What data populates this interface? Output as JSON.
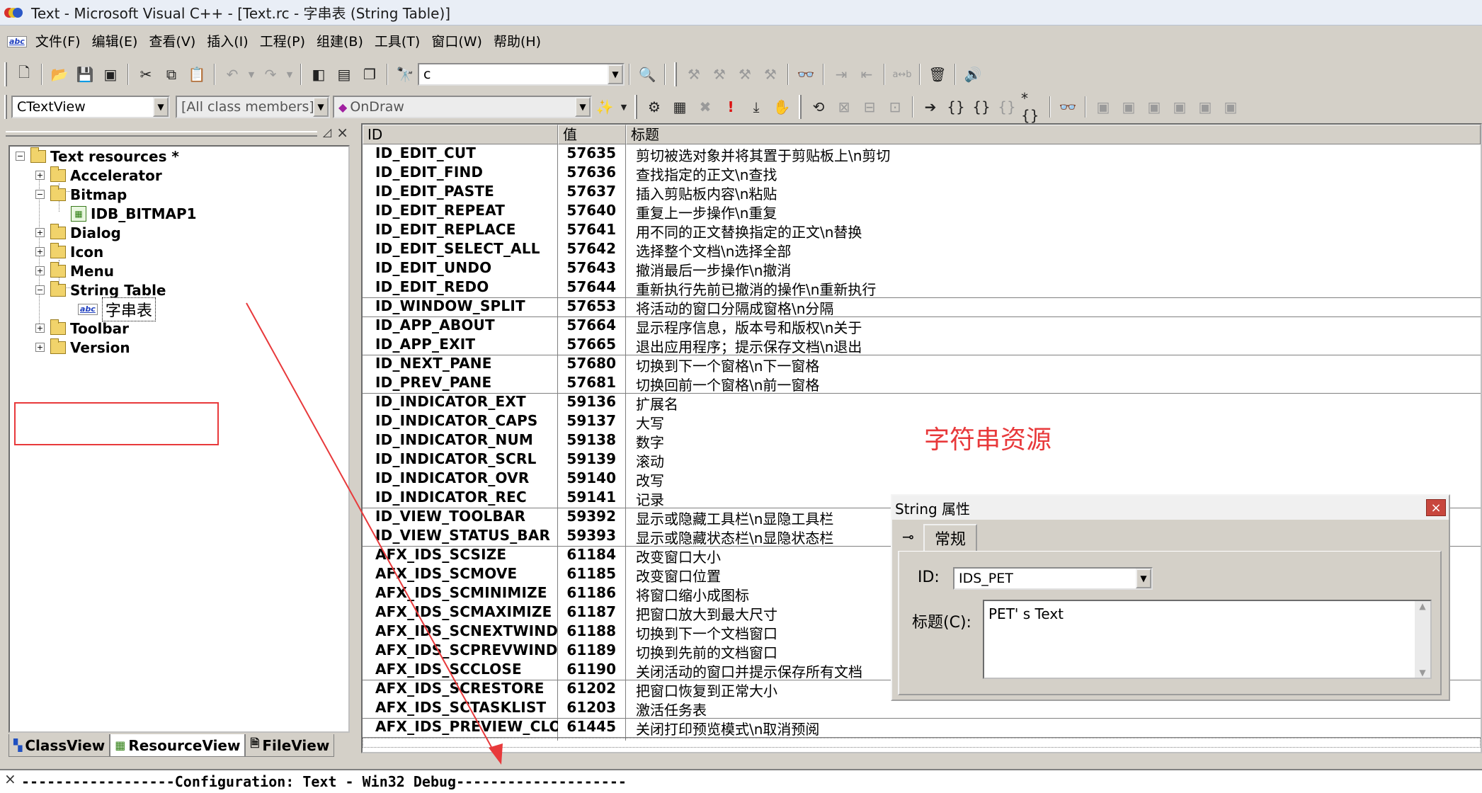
{
  "window": {
    "title": "Text - Microsoft Visual C++ - [Text.rc - 字串表 (String Table)]"
  },
  "menu": [
    "文件(F)",
    "编辑(E)",
    "查看(V)",
    "插入(I)",
    "工程(P)",
    "组建(B)",
    "工具(T)",
    "窗口(W)",
    "帮助(H)"
  ],
  "toolbar1": {
    "find_value": "c"
  },
  "toolbar2": {
    "class_combo": "CTextView",
    "filter_combo": "[All class members]",
    "member_combo": "OnDraw"
  },
  "workspace": {
    "tree": {
      "root": "Text resources *",
      "accelerator": "Accelerator",
      "bitmap": "Bitmap",
      "bitmap_child": "IDB_BITMAP1",
      "dialog": "Dialog",
      "icon": "Icon",
      "menu": "Menu",
      "string_table": "String Table",
      "string_table_child": "字串表",
      "toolbar": "Toolbar",
      "version": "Version"
    },
    "tabs": [
      "ClassView",
      "ResourceView",
      "FileView"
    ]
  },
  "string_table": {
    "columns": [
      "ID",
      "值",
      "标题"
    ],
    "rows": [
      {
        "id": "ID_EDIT_CUT",
        "value": "57635",
        "caption": "剪切被选对象并将其置于剪贴板上\\n剪切"
      },
      {
        "id": "ID_EDIT_FIND",
        "value": "57636",
        "caption": "查找指定的正文\\n查找"
      },
      {
        "id": "ID_EDIT_PASTE",
        "value": "57637",
        "caption": "插入剪贴板内容\\n粘贴"
      },
      {
        "id": "ID_EDIT_REPEAT",
        "value": "57640",
        "caption": "重复上一步操作\\n重复"
      },
      {
        "id": "ID_EDIT_REPLACE",
        "value": "57641",
        "caption": "用不同的正文替换指定的正文\\n替换"
      },
      {
        "id": "ID_EDIT_SELECT_ALL",
        "value": "57642",
        "caption": "选择整个文档\\n选择全部"
      },
      {
        "id": "ID_EDIT_UNDO",
        "value": "57643",
        "caption": "撤消最后一步操作\\n撤消"
      },
      {
        "id": "ID_EDIT_REDO",
        "value": "57644",
        "caption": "重新执行先前已撤消的操作\\n重新执行"
      },
      {
        "id": "ID_WINDOW_SPLIT",
        "value": "57653",
        "caption": "将活动的窗口分隔成窗格\\n分隔"
      },
      {
        "id": "ID_APP_ABOUT",
        "value": "57664",
        "caption": "显示程序信息，版本号和版权\\n关于"
      },
      {
        "id": "ID_APP_EXIT",
        "value": "57665",
        "caption": "退出应用程序；提示保存文档\\n退出"
      },
      {
        "id": "ID_NEXT_PANE",
        "value": "57680",
        "caption": "切换到下一个窗格\\n下一窗格"
      },
      {
        "id": "ID_PREV_PANE",
        "value": "57681",
        "caption": "切换回前一个窗格\\n前一窗格"
      },
      {
        "id": "ID_INDICATOR_EXT",
        "value": "59136",
        "caption": "扩展名"
      },
      {
        "id": "ID_INDICATOR_CAPS",
        "value": "59137",
        "caption": "大写"
      },
      {
        "id": "ID_INDICATOR_NUM",
        "value": "59138",
        "caption": "数字"
      },
      {
        "id": "ID_INDICATOR_SCRL",
        "value": "59139",
        "caption": "滚动"
      },
      {
        "id": "ID_INDICATOR_OVR",
        "value": "59140",
        "caption": "改写"
      },
      {
        "id": "ID_INDICATOR_REC",
        "value": "59141",
        "caption": "记录"
      },
      {
        "id": "ID_VIEW_TOOLBAR",
        "value": "59392",
        "caption": "显示或隐藏工具栏\\n显隐工具栏"
      },
      {
        "id": "ID_VIEW_STATUS_BAR",
        "value": "59393",
        "caption": "显示或隐藏状态栏\\n显隐状态栏"
      },
      {
        "id": "AFX_IDS_SCSIZE",
        "value": "61184",
        "caption": "改变窗口大小"
      },
      {
        "id": "AFX_IDS_SCMOVE",
        "value": "61185",
        "caption": "改变窗口位置"
      },
      {
        "id": "AFX_IDS_SCMINIMIZE",
        "value": "61186",
        "caption": "将窗口缩小成图标"
      },
      {
        "id": "AFX_IDS_SCMAXIMIZE",
        "value": "61187",
        "caption": "把窗口放大到最大尺寸"
      },
      {
        "id": "AFX_IDS_SCNEXTWINDOW",
        "value": "61188",
        "caption": "切换到下一个文档窗口"
      },
      {
        "id": "AFX_IDS_SCPREVWINDOW",
        "value": "61189",
        "caption": "切换到先前的文档窗口"
      },
      {
        "id": "AFX_IDS_SCCLOSE",
        "value": "61190",
        "caption": "关闭活动的窗口并提示保存所有文档"
      },
      {
        "id": "AFX_IDS_SCRESTORE",
        "value": "61202",
        "caption": "把窗口恢复到正常大小"
      },
      {
        "id": "AFX_IDS_SCTASKLIST",
        "value": "61203",
        "caption": "激活任务表"
      },
      {
        "id": "AFX_IDS_PREVIEW_CLOSE",
        "value": "61445",
        "caption": "关闭打印预览模式\\n取消预阅"
      }
    ]
  },
  "annotation": {
    "label": "字符串资源",
    "color": "#e8393b"
  },
  "properties": {
    "title": "String 属性",
    "close": "×",
    "tab": "常规",
    "id_label": "ID:",
    "id_value": "IDS_PET",
    "caption_label": "标题(C):",
    "caption_value": "PET' s Text"
  },
  "output": {
    "text": "------------------Configuration: Text - Win32 Debug--------------------"
  }
}
